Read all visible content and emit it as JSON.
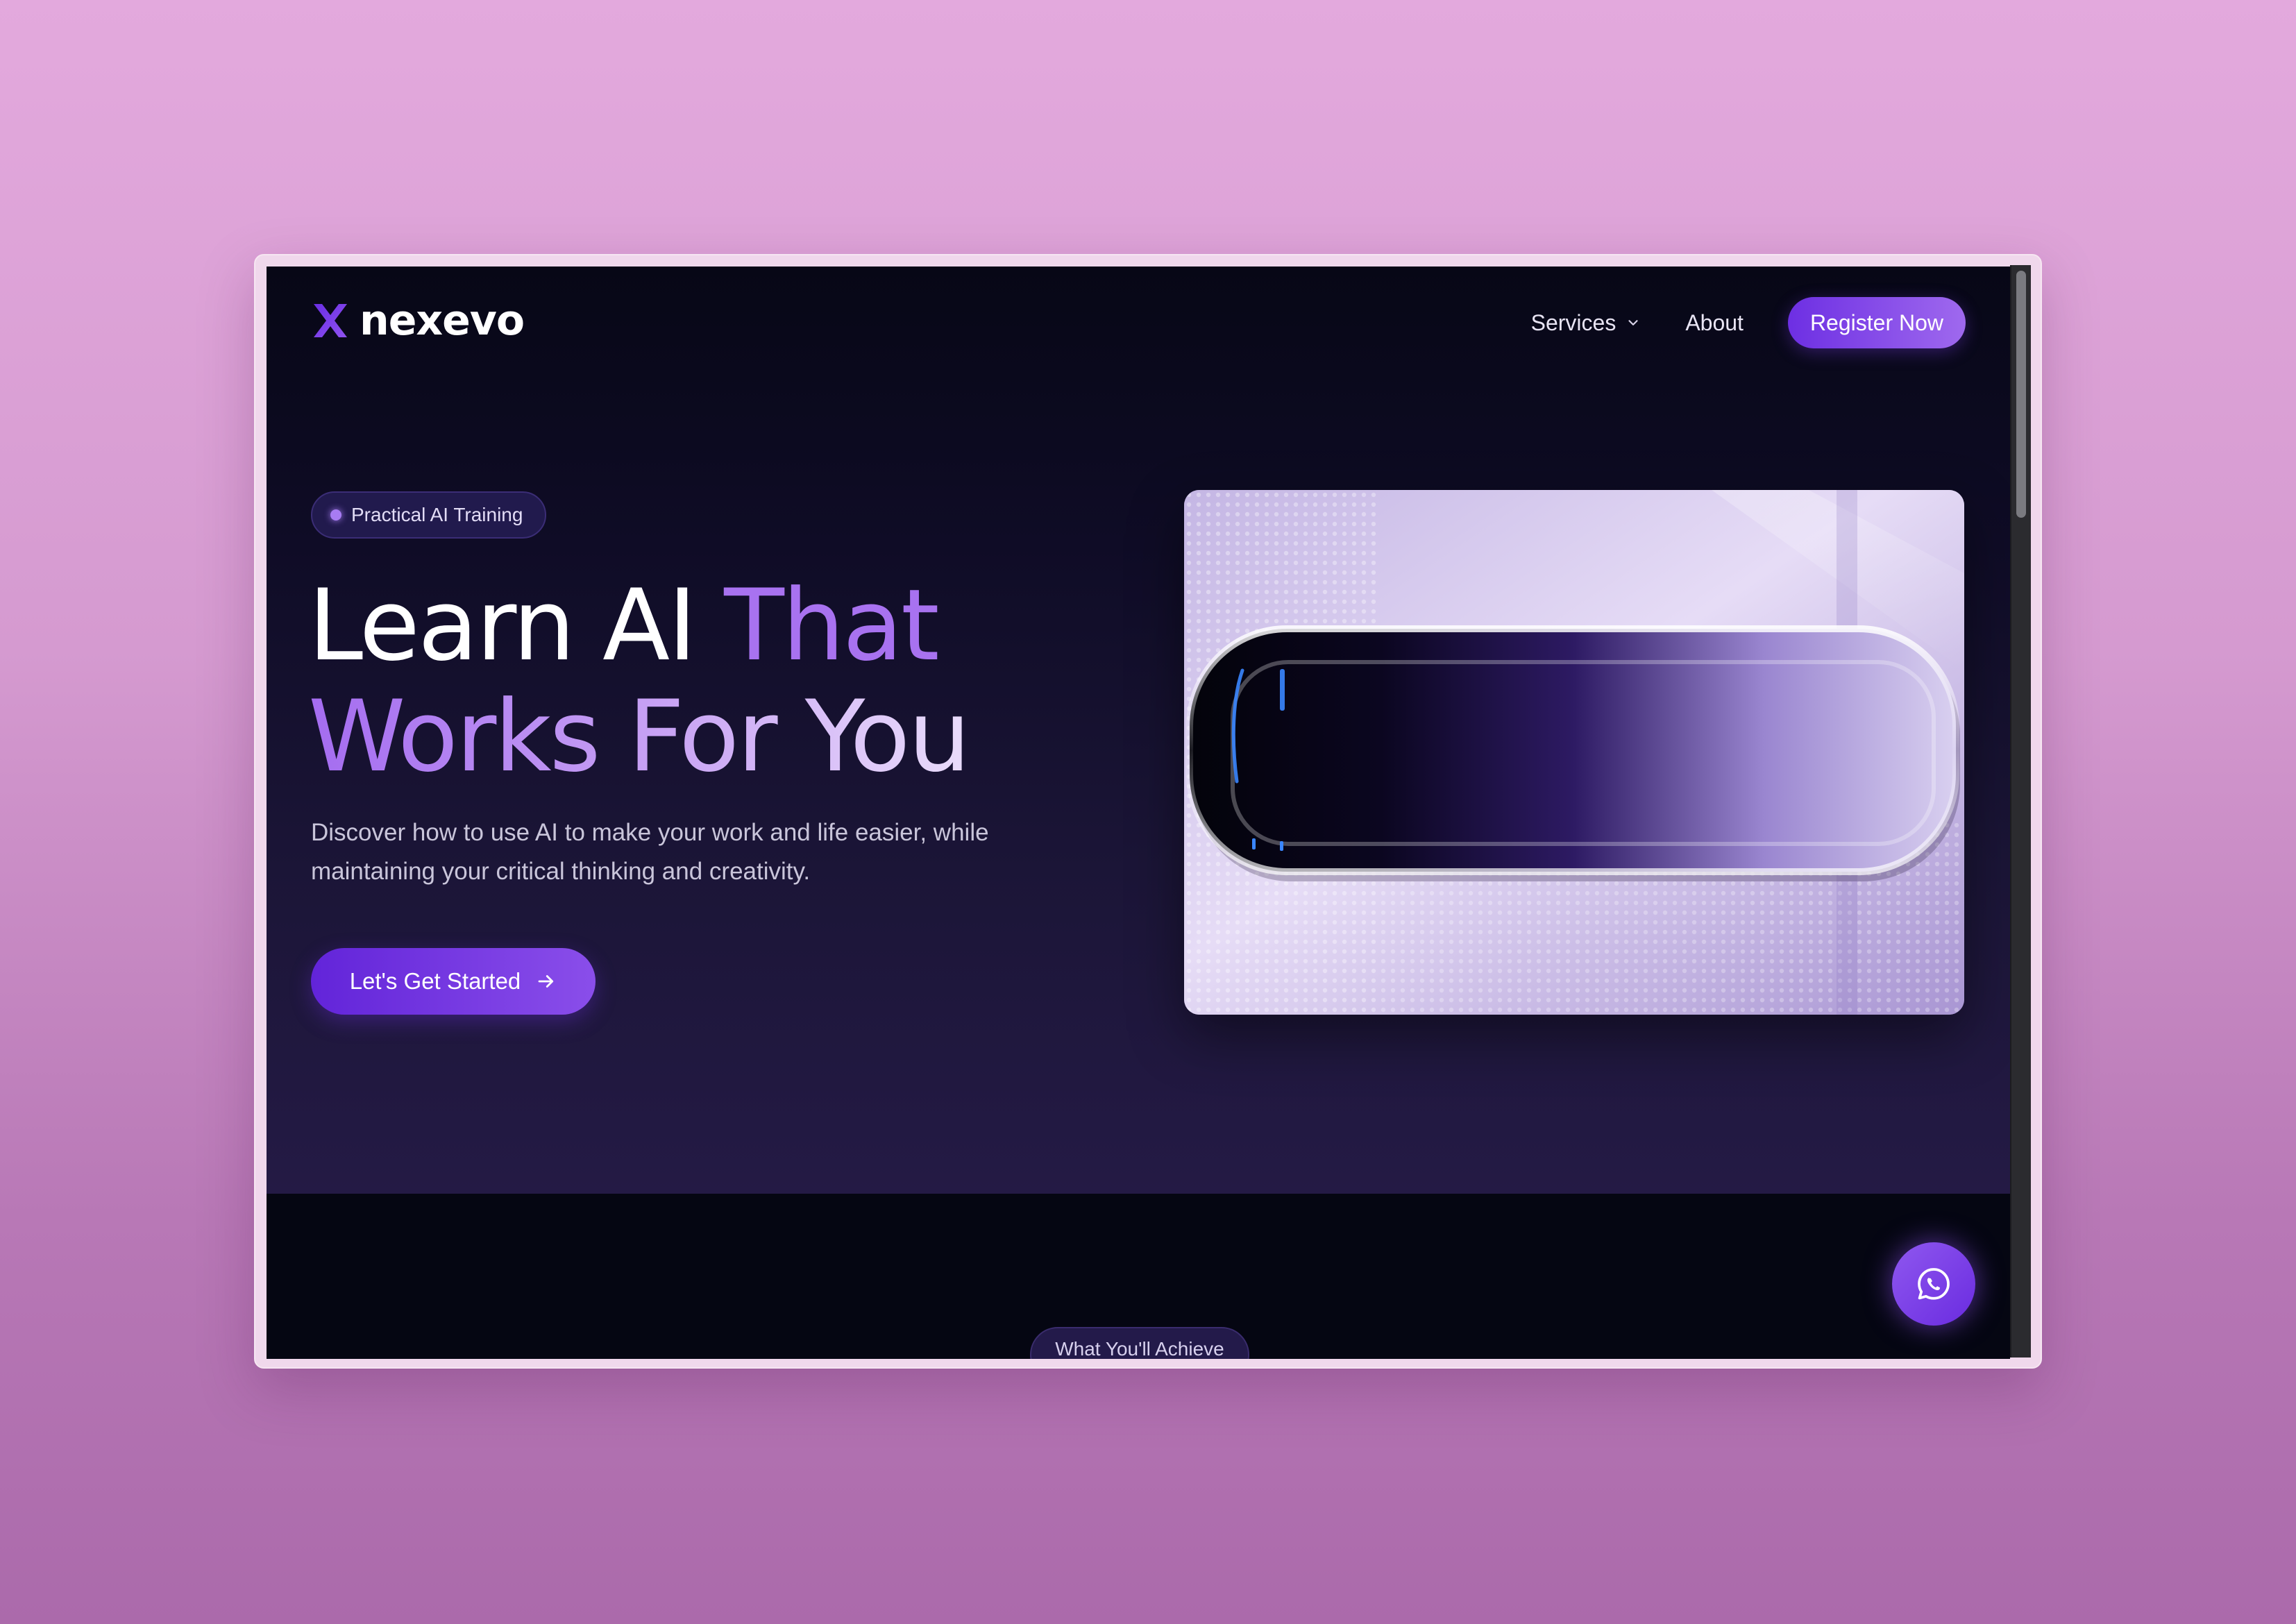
{
  "brand": {
    "name": "nexevo",
    "logo_icon": "x-logo-icon",
    "accent_color": "#7c3aed"
  },
  "nav": {
    "services_label": "Services",
    "about_label": "About",
    "register_label": "Register Now"
  },
  "hero": {
    "badge_text": "Practical AI Training",
    "headline_part1": "Learn AI ",
    "headline_part2": "That",
    "headline_part3": "Works For You",
    "subtext": "Discover how to use AI to make your work and life easier, while maintaining your critical thinking and creativity.",
    "cta_label": "Let's Get Started",
    "image_icon": "glass-capsule-image"
  },
  "next_section": {
    "pill_label": "What You'll Achieve"
  },
  "floating": {
    "whatsapp_icon": "whatsapp-icon"
  }
}
